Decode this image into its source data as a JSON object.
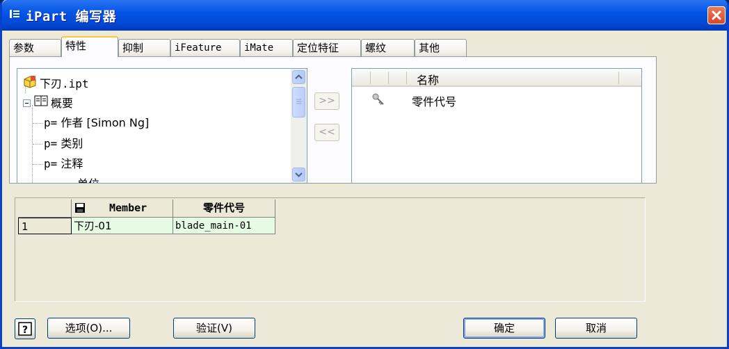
{
  "window": {
    "title": "iPart 编写器",
    "close_icon": "close-icon"
  },
  "tabs": [
    {
      "label": "参数"
    },
    {
      "label": "特性"
    },
    {
      "label": "抑制"
    },
    {
      "label": "iFeature"
    },
    {
      "label": "iMate"
    },
    {
      "label": "定位特征"
    },
    {
      "label": "螺纹"
    },
    {
      "label": "其他"
    }
  ],
  "active_tab": "特性",
  "tree": {
    "root": "下刃.ipt",
    "group": "概要",
    "items": [
      {
        "prefix": "p=",
        "label": "作者 [Simon Ng]"
      },
      {
        "prefix": "p=",
        "label": "类别"
      },
      {
        "prefix": "p=",
        "label": "注释"
      },
      {
        "prefix": "",
        "label": "单位"
      }
    ]
  },
  "transfer": {
    "add": ">>",
    "remove": "<<"
  },
  "selected_list": {
    "header_name": "名称",
    "items": [
      {
        "icon": "key-icon",
        "label": "零件代号"
      }
    ]
  },
  "table": {
    "headers": [
      "",
      "Member",
      "零件代号"
    ],
    "rows": [
      {
        "index": "1",
        "member": "下刃-01",
        "part_no": "blade_main-01"
      }
    ]
  },
  "buttons": {
    "help": "?",
    "options": "选项(O)...",
    "verify": "验证(V)",
    "ok": "确定",
    "cancel": "取消"
  }
}
